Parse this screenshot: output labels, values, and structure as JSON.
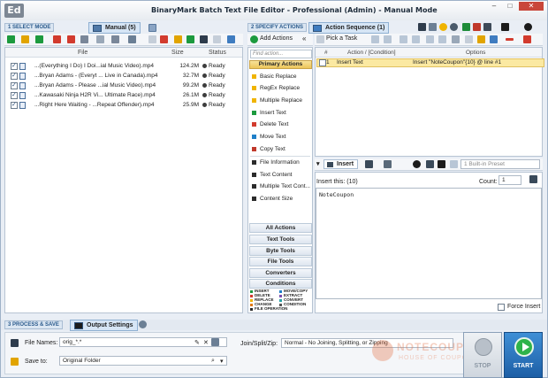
{
  "app": {
    "logo": "Ed",
    "title": "BinaryMark  Batch Text File Editor - Professional (Admin) - Manual  Mode",
    "window_buttons": {
      "minimize": "–",
      "maximize": "□",
      "close": "✕"
    }
  },
  "sections": {
    "select_mode": "1 SELECT MODE",
    "specify_actions": "2 SPECIFY ACTIONS",
    "process_save": "3 PROCESS & SAVE"
  },
  "tabs": {
    "manual": "Manual (5)",
    "action_sequence": "Action Sequence (1)",
    "output_settings": "Output Settings"
  },
  "file_list": {
    "columns": {
      "file": "File",
      "size": "Size",
      "status": "Status"
    },
    "rows": [
      {
        "name": "...(Everything I Do) I Doi...ial Music Video).mp4",
        "size": "124.2M",
        "status": "Ready"
      },
      {
        "name": "...Bryan Adams - (Everyt ... Live in Canada).mp4",
        "size": "32.7M",
        "status": "Ready"
      },
      {
        "name": "...Bryan Adams - Please ...ial Music Video).mp4",
        "size": "99.2M",
        "status": "Ready"
      },
      {
        "name": "...Kawasaki Ninja H2R Vi... Ultimate Race).mp4",
        "size": "26.1M",
        "status": "Ready"
      },
      {
        "name": "...Right  Here Waiting - ...Repeat Offender).mp4",
        "size": "25.9M",
        "status": "Ready"
      }
    ]
  },
  "actions_panel": {
    "add_actions": "Add Actions",
    "collapse": "«",
    "search_placeholder": "Find action...",
    "primary_header": "Primary Actions",
    "primary_items": [
      {
        "label": "Basic Replace",
        "color": "#f0b400"
      },
      {
        "label": "RegEx Replace",
        "color": "#f0b400"
      },
      {
        "label": "Multiple Replace",
        "color": "#f0b400"
      },
      {
        "label": "Insert Text",
        "color": "#1c9a3e"
      },
      {
        "label": "Delete Text",
        "color": "#d23b2e"
      },
      {
        "label": "Move Text",
        "color": "#1f7fc8"
      },
      {
        "label": "Copy Text",
        "color": "#c0392b"
      }
    ],
    "secondary_items": [
      {
        "label": "File Information",
        "color": "#2b2b2b"
      },
      {
        "label": "Text Content",
        "color": "#2b2b2b"
      },
      {
        "label": "Multiple Text Cont...",
        "color": "#2b2b2b"
      },
      {
        "label": "Content Size",
        "color": "#2b2b2b"
      }
    ],
    "groups": [
      "All Actions",
      "Text Tools",
      "Byte Tools",
      "File Tools",
      "Converters",
      "Conditions"
    ],
    "legend": [
      {
        "label": "INSERT",
        "color": "#1c9a3e"
      },
      {
        "label": "MOVE/COPY",
        "color": "#1f7fc8"
      },
      {
        "label": "DELETE",
        "color": "#d23b2e"
      },
      {
        "label": "EXTRACT",
        "color": "#7a4fb0"
      },
      {
        "label": "REPLACE",
        "color": "#f0b400"
      },
      {
        "label": "CONVERT",
        "color": "#2aa3a8"
      },
      {
        "label": "CHANGE",
        "color": "#e07a1a"
      },
      {
        "label": "CONDITION",
        "color": "#555555"
      },
      {
        "label": "FILE OPERATION",
        "color": "#2b2b2b"
      }
    ]
  },
  "sequence": {
    "pick_task": "Pick a Task",
    "columns": {
      "num": "#",
      "action": "Action / [Condition]",
      "options": "Options"
    },
    "rows": [
      {
        "num": "1",
        "action": "Insert Text",
        "options": "Insert \"NoteCoupon\"{10} @ line #1"
      }
    ]
  },
  "insert_editor": {
    "tab_label": "Insert",
    "preset": "1 Built-in Preset",
    "insert_this_label": "Insert this: (10)",
    "count_label": "Count:",
    "count_value": "1",
    "text_value": "NoteCoupon",
    "force_insert": "Force Insert"
  },
  "output": {
    "file_names_label": "File Names:",
    "file_names_value": "orig_*.*",
    "save_to_label": "Save to:",
    "save_to_value": "Original Folder",
    "join_label": "Join/Split/Zip:",
    "join_value": "Normal - No Joining, Splitting, or Zipping",
    "stop_label": "STOP",
    "start_label": "START"
  },
  "watermark": {
    "line1": "NOTECOUPON",
    "line2": "HOUSE OF COUPON"
  }
}
